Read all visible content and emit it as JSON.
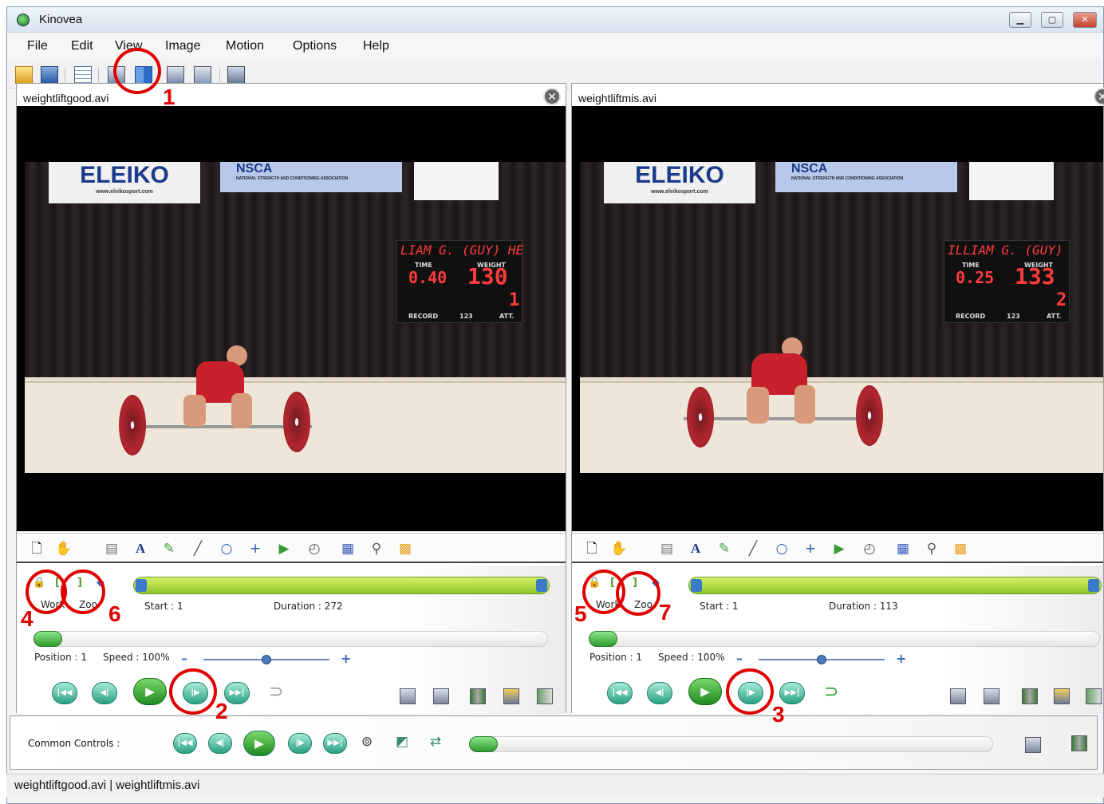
{
  "window": {
    "title": "Kinovea"
  },
  "menu": [
    "File",
    "Edit",
    "View",
    "Image",
    "Motion",
    "Options",
    "Help"
  ],
  "panes": [
    {
      "file": "weightliftgood.avi",
      "scoreboard": {
        "name": "LIAM G. (GUY) HE",
        "time_label": "TIME",
        "time": "0.40",
        "weight_label": "WEIGHT",
        "weight": "130",
        "attempt": "1",
        "record_label": "RECORD",
        "record": "123",
        "att_label": "ATT."
      },
      "working_zone": {
        "work_label": "Work",
        "zoom_label": "Zoo",
        "start": "Start : 1",
        "duration": "Duration : 272"
      },
      "position": "Position : 1",
      "speed": "Speed : 100%",
      "speed_level": 0.5
    },
    {
      "file": "weightliftmis.avi",
      "scoreboard": {
        "name": "ILLIAM G. (GUY)",
        "time_label": "TIME",
        "time": "0.25",
        "weight_label": "WEIGHT",
        "weight": "133",
        "attempt": "2",
        "record_label": "RECORD",
        "record": "123",
        "att_label": "ATT."
      },
      "working_zone": {
        "work_label": "Work",
        "zoom_label": "Zoo",
        "start": "Start : 1",
        "duration": "Duration : 113"
      },
      "position": "Position : 1",
      "speed": "Speed : 100%",
      "speed_level": 0.5
    }
  ],
  "banners": {
    "eleiko": "ELEIKO",
    "eleiko_url": "www.eleikosport.com",
    "nsca": "NSCA",
    "nsca_sub": "NATIONAL STRENGTH AND CONDITIONING ASSOCIATION"
  },
  "common": {
    "label": "Common Controls :"
  },
  "status": "weightliftgood.avi | weightliftmis.avi",
  "annotations": [
    "1",
    "2",
    "3",
    "4",
    "5",
    "6",
    "7"
  ],
  "colors": {
    "annotation": "#e00000",
    "selection": "#8cc72a",
    "playback": "#2aa083"
  }
}
